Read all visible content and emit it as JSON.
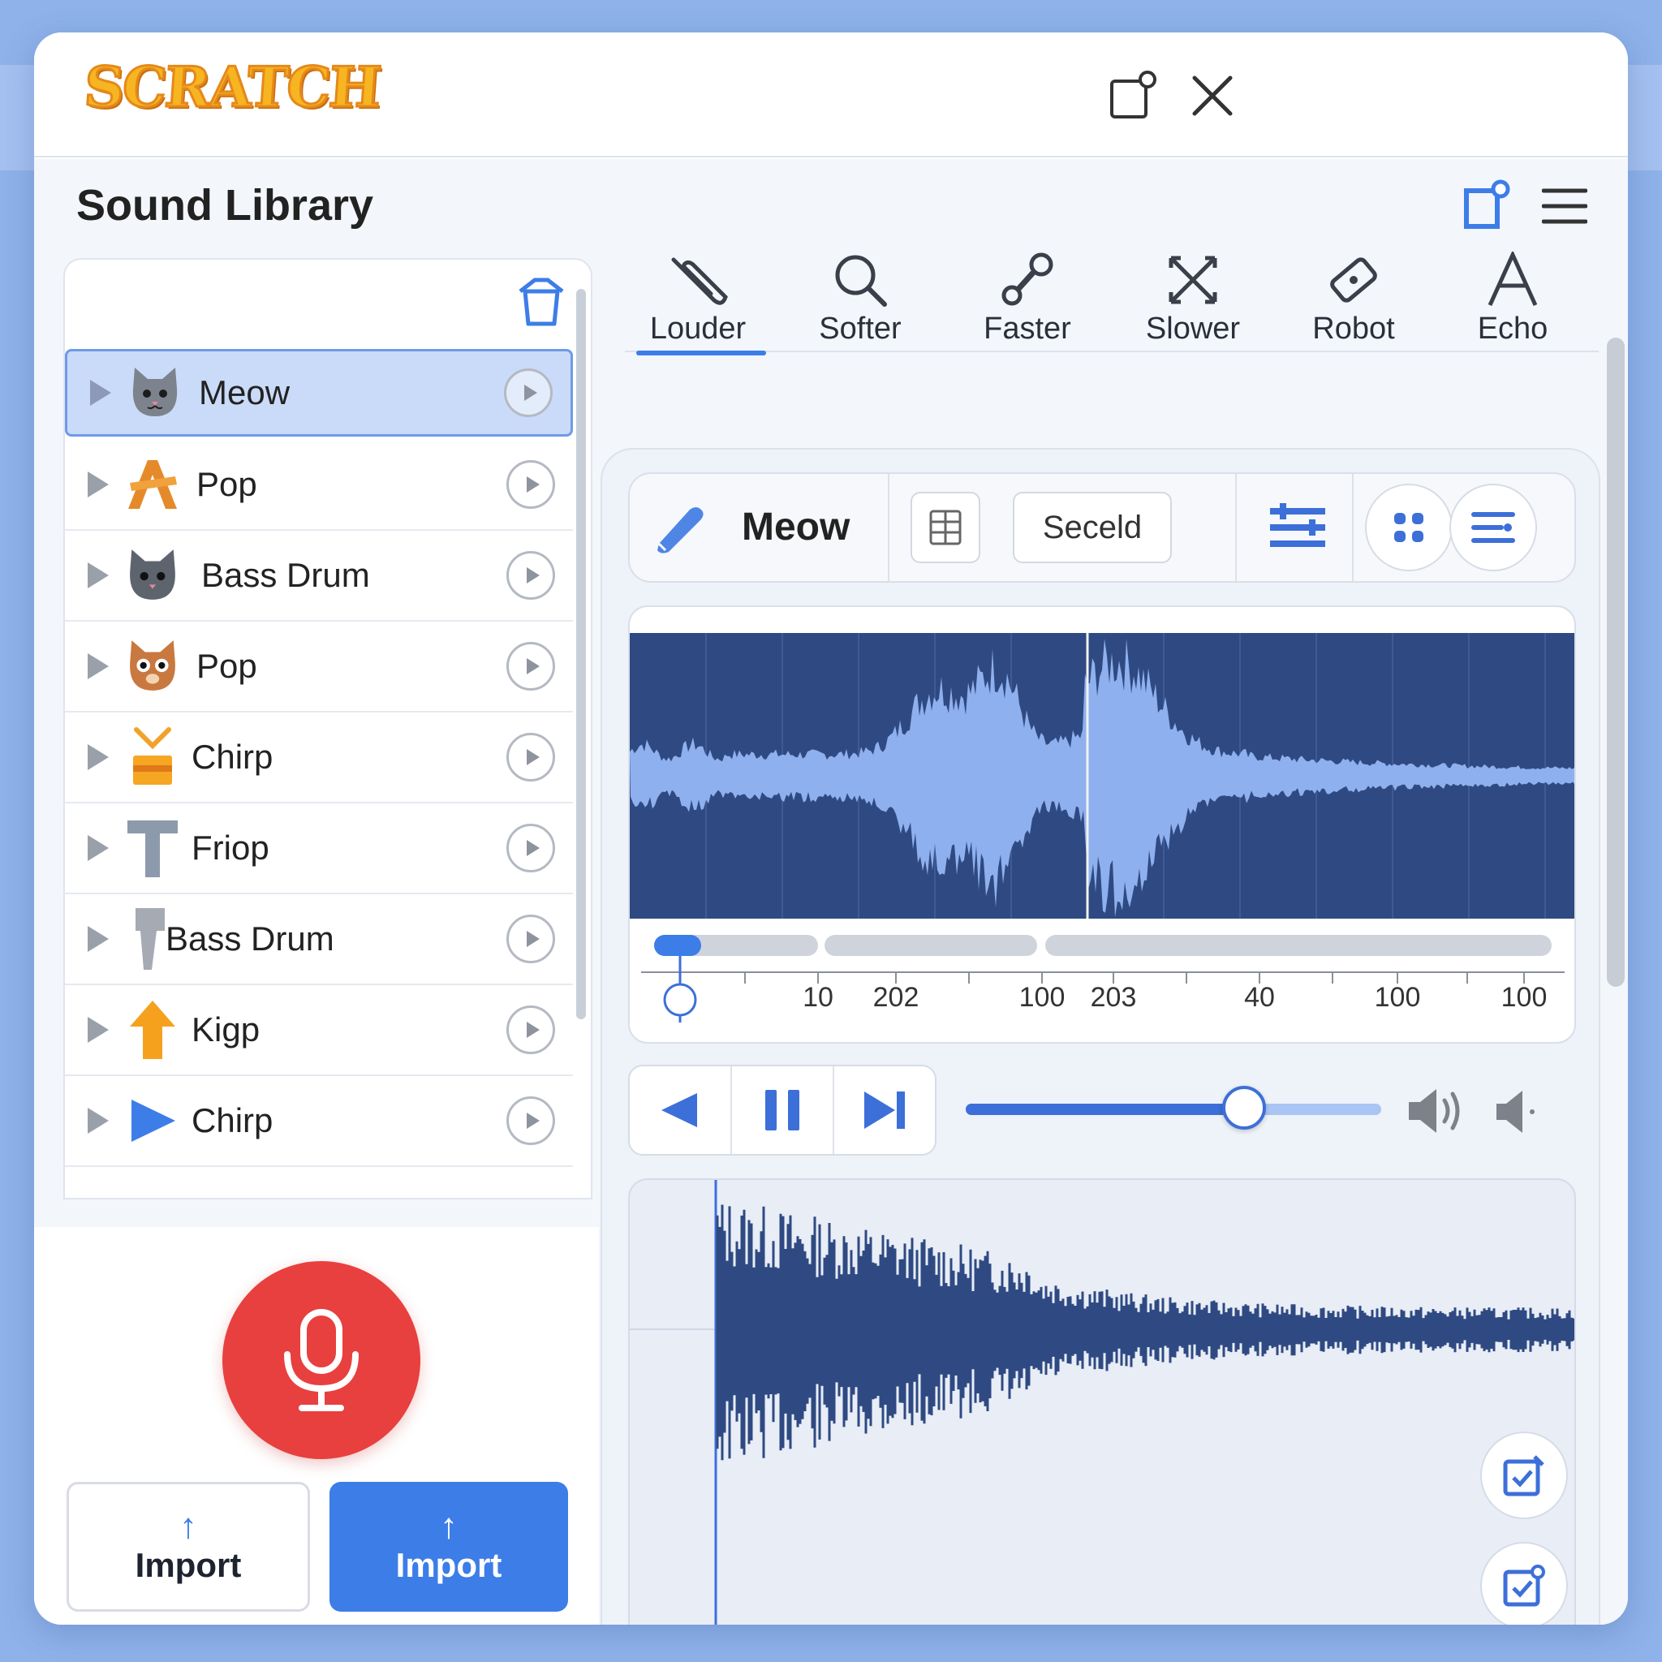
{
  "app": {
    "logo_text": "SCRATCH",
    "window_icons": [
      "popout-icon",
      "close-icon"
    ]
  },
  "header": {
    "title": "Sound Library",
    "icons": [
      "popout-icon",
      "menu-icon"
    ]
  },
  "sound_list": [
    {
      "name": "Meow",
      "icon": "cat-gray-icon",
      "selected": true
    },
    {
      "name": "Pop",
      "icon": "pop-letter-icon",
      "selected": false
    },
    {
      "name": "Bass Drum",
      "icon": "cat-gray-icon",
      "selected": false
    },
    {
      "name": "Pop",
      "icon": "cat-orange-icon",
      "selected": false
    },
    {
      "name": "Chirp",
      "icon": "chirp-icon",
      "selected": false
    },
    {
      "name": "Friop",
      "icon": "letter-t-icon",
      "selected": false
    },
    {
      "name": "Bass Drum",
      "icon": "hammer-icon",
      "selected": false
    },
    {
      "name": "Kigp",
      "icon": "arrow-up-icon",
      "selected": false
    },
    {
      "name": "Chirp",
      "icon": "play-triangle-icon",
      "selected": false
    }
  ],
  "buttons": {
    "import_secondary": "Import",
    "import_primary": "Import"
  },
  "effects": [
    {
      "label": "Louder",
      "icon": "paperclip-icon",
      "active": true
    },
    {
      "label": "Softer",
      "icon": "search-icon",
      "active": false
    },
    {
      "label": "Faster",
      "icon": "wrench-icon",
      "active": false
    },
    {
      "label": "Slower",
      "icon": "cross-arrows-icon",
      "active": false
    },
    {
      "label": "Robot",
      "icon": "robot-tag-icon",
      "active": false
    },
    {
      "label": "Echo",
      "icon": "letter-a-icon",
      "active": false
    }
  ],
  "editor": {
    "sound_name": "Meow",
    "select_label": "Seceld",
    "timeline_ticks": [
      "10",
      "202",
      "100",
      "203",
      "40",
      "100",
      "100"
    ],
    "volume_level": 0.67
  },
  "colors": {
    "accent": "#3d7de8",
    "record": "#e8403e",
    "waveform_bg": "#2f4a82",
    "waveform_fg": "#8fb0ee"
  }
}
